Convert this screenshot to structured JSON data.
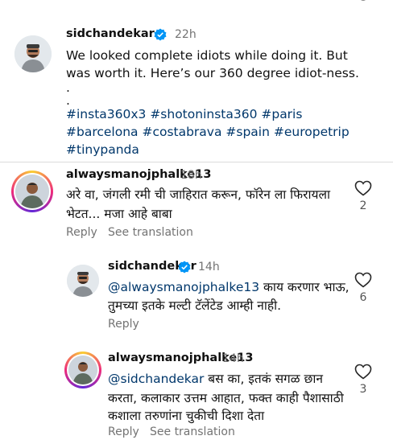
{
  "colors": {
    "link": "#00376b",
    "muted": "#737373",
    "verified": "#0095f6",
    "divider": "#dbdbdb"
  },
  "post_caption": {
    "username": "sidchandekar",
    "verified": true,
    "time": "22h",
    "text_line1": "We looked complete idiots while doing it. But",
    "text_line2": "was worth it. Here’s our 360 degree idiot-ness.",
    "dot1": ".",
    "dot2": ".",
    "hashtags_line1": "#insta360x3 #shotoninsta360 #paris",
    "hashtags_line2": "#barcelona #costabrava #spain #europetrip",
    "hashtags_line3": "#tinypanda"
  },
  "comments": [
    {
      "username": "alwaysmanojphalke13",
      "time": "18h",
      "text_line1": "अरे वा, जंगली रमी ची जाहिरात करून, फॉरेन ला फिरायला",
      "text_line2": "भेटत... मजा आहे बाबा",
      "likes": "2",
      "reply_label": "Reply",
      "translate_label": "See translation",
      "heart_icon": "heart-outline-icon"
    },
    {
      "username": "sidchandekar",
      "verified": true,
      "time": "14h",
      "mention": "@alwaysmanojphalke13",
      "text_line1_rest": " काय करणार भाऊ,",
      "text_line2": "तुमच्या इतके मल्टी टॅलेंटेड आम्ही नाही.",
      "likes": "6",
      "reply_label": "Reply",
      "heart_icon": "heart-outline-icon"
    },
    {
      "username": "alwaysmanojphalke13",
      "time": "14h",
      "mention": "@sidchandekar",
      "text_line1_rest": " बस का, इतकं सगळ छान",
      "text_line2": "करता, कलाकार उत्तम आहात, फक्त काही पैशासाठी",
      "text_line3": "कशाला तरुणांना चुकीची दिशा देता",
      "likes": "3",
      "reply_label": "Reply",
      "translate_label": "See translation",
      "heart_icon": "heart-outline-icon"
    }
  ]
}
